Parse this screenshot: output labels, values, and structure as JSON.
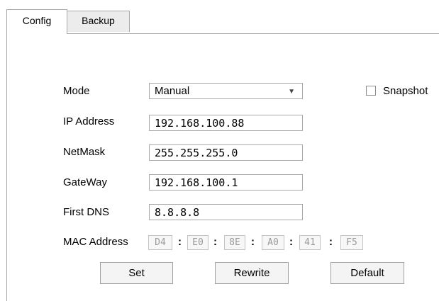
{
  "tabs": [
    {
      "label": "Config",
      "active": true
    },
    {
      "label": "Backup",
      "active": false
    }
  ],
  "form": {
    "mode": {
      "label": "Mode",
      "value": "Manual"
    },
    "snapshot": {
      "label": "Snapshot",
      "checked": false
    },
    "ip_address": {
      "label": "IP Address",
      "value": "192.168.100.88"
    },
    "netmask": {
      "label": "NetMask",
      "value": "255.255.255.0"
    },
    "gateway": {
      "label": "GateWay",
      "value": "192.168.100.1"
    },
    "first_dns": {
      "label": "First DNS",
      "value": "8.8.8.8"
    },
    "mac": {
      "label": "MAC Address",
      "segments": [
        "D4",
        "E0",
        "8E",
        "A0",
        "41",
        "F5"
      ],
      "separator": ":"
    }
  },
  "buttons": {
    "set": "Set",
    "rewrite": "Rewrite",
    "default": "Default"
  },
  "icons": {
    "dropdown": "chevron-down-icon",
    "checkbox": "checkbox-unchecked-icon"
  }
}
